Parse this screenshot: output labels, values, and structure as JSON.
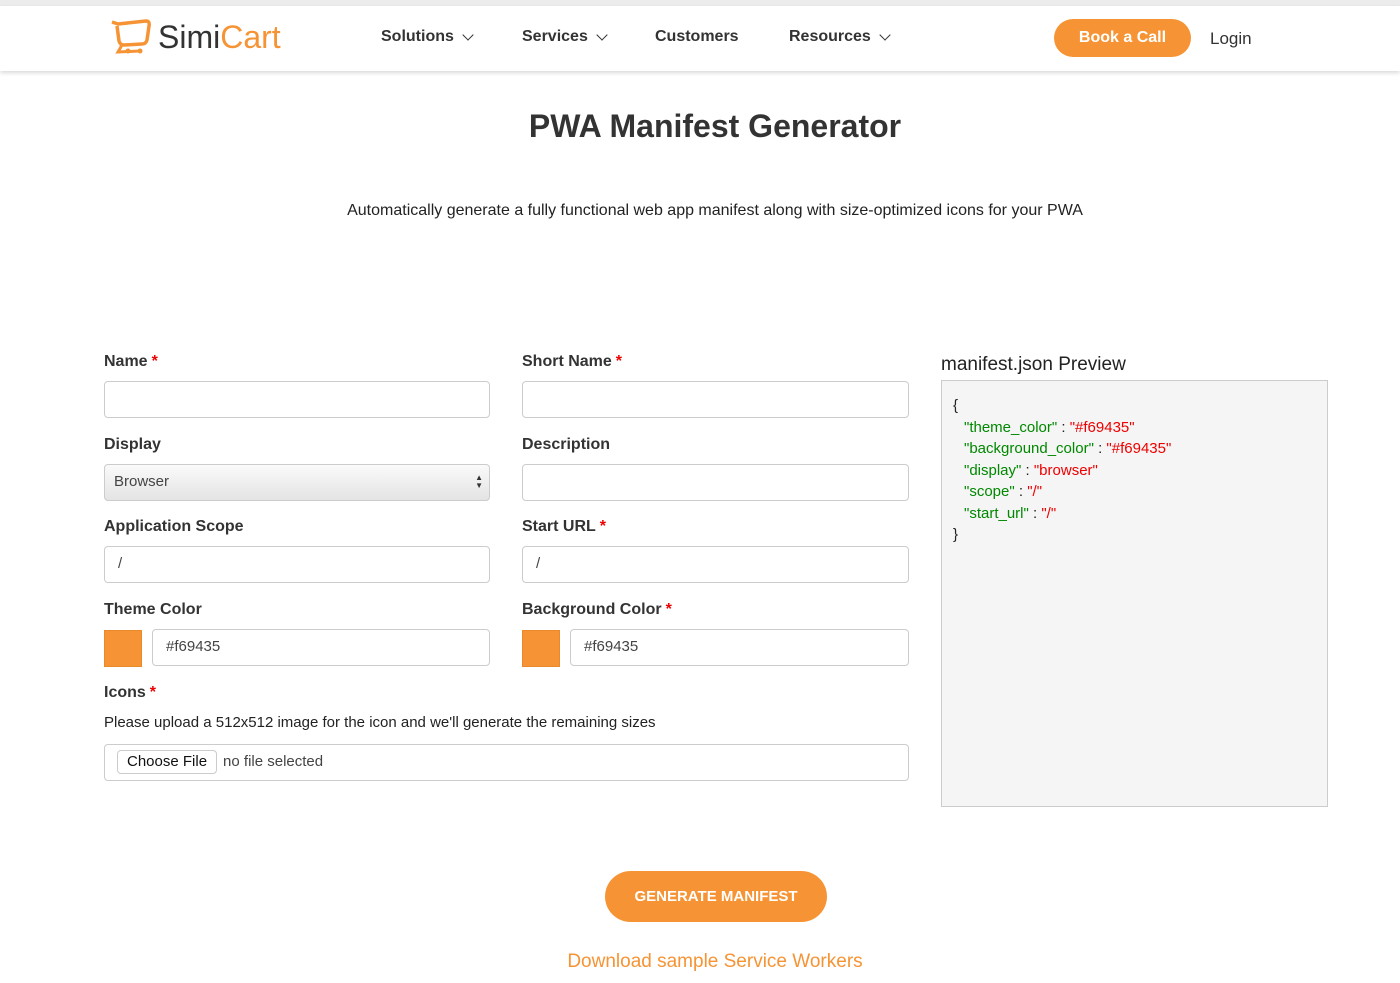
{
  "brand": {
    "logo_part1": "Simi",
    "logo_part2": "Cart",
    "accent": "#f69435"
  },
  "nav": {
    "items": [
      {
        "label": "Solutions",
        "dropdown": true
      },
      {
        "label": "Services",
        "dropdown": true
      },
      {
        "label": "Customers",
        "dropdown": false
      },
      {
        "label": "Resources",
        "dropdown": true
      }
    ],
    "book_call": "Book a Call",
    "login": "Login"
  },
  "page": {
    "title": "PWA Manifest Generator",
    "subtitle": "Automatically generate a fully functional web app manifest along with size-optimized icons for your PWA"
  },
  "form": {
    "name": {
      "label": "Name",
      "value": ""
    },
    "short_name": {
      "label": "Short Name",
      "value": ""
    },
    "display": {
      "label": "Display",
      "value": "Browser"
    },
    "description": {
      "label": "Description",
      "value": ""
    },
    "scope": {
      "label": "Application Scope",
      "value": "/"
    },
    "start_url": {
      "label": "Start URL",
      "value": "/"
    },
    "theme_color": {
      "label": "Theme Color",
      "value": "#f69435"
    },
    "background_color": {
      "label": "Background Color",
      "value": "#f69435"
    },
    "icons": {
      "label": "Icons",
      "help": "Please upload a 512x512 image for the icon and we'll generate the remaining sizes",
      "choose": "Choose File",
      "status": "no file selected"
    },
    "required_mark": "*"
  },
  "preview": {
    "title": "manifest.json Preview",
    "open": "{",
    "close": "}",
    "lines": [
      {
        "key": "\"theme_color\"",
        "value": "\"#f69435\""
      },
      {
        "key": "\"background_color\"",
        "value": "\"#f69435\""
      },
      {
        "key": "\"display\"",
        "value": "\"browser\""
      },
      {
        "key": "\"scope\"",
        "value": "\"/\""
      },
      {
        "key": "\"start_url\"",
        "value": "\"/\""
      }
    ],
    "sep": " : "
  },
  "actions": {
    "generate": "GENERATE MANIFEST",
    "download": "Download sample Service Workers"
  }
}
